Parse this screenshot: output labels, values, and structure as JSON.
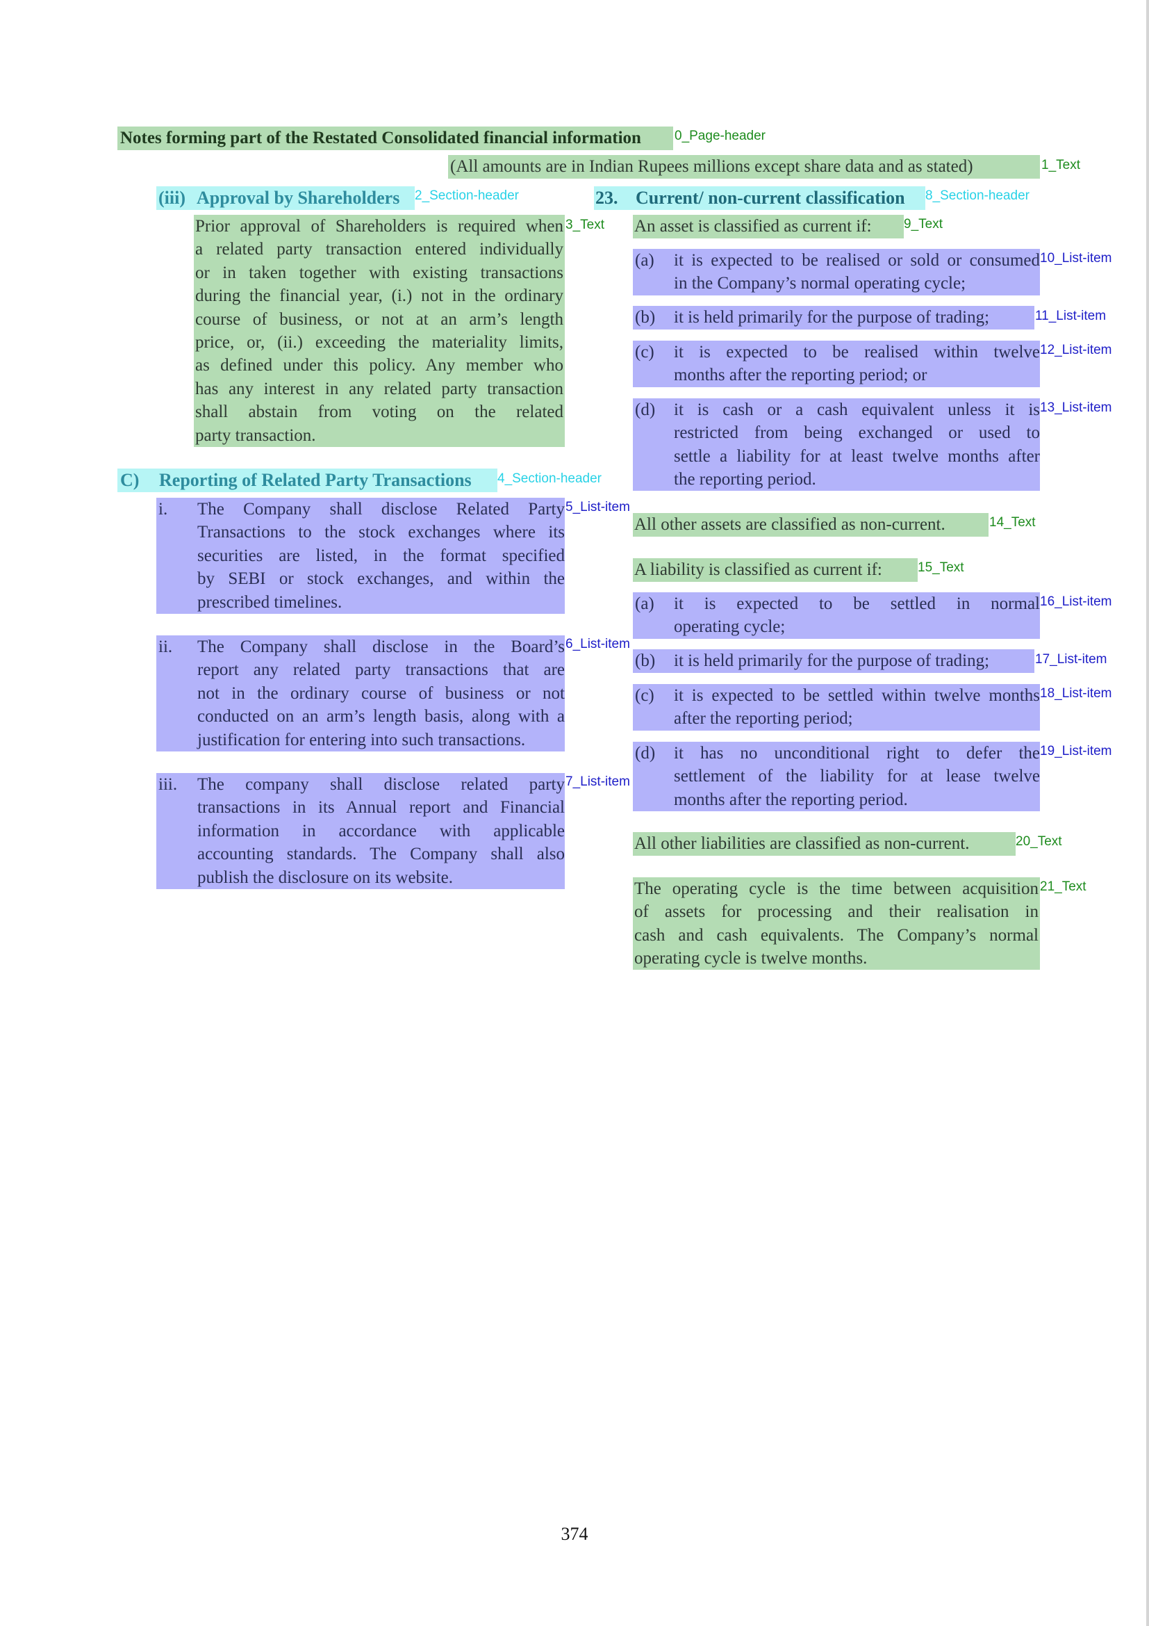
{
  "page_header": "Notes forming part of the Restated Consolidated financial information",
  "currency_note": "(All amounts are in Indian Rupees millions except share data and as stated)",
  "labels": {
    "l0": "0_Page-header",
    "l1": "1_Text",
    "l2": "2_Section-header",
    "l3": "3_Text",
    "l4": "4_Section-header",
    "l5": "5_List-item",
    "l6": "6_List-item",
    "l7": "7_List-item",
    "l8": "8_Section-header",
    "l9": "9_Text",
    "l10": "10_List-item",
    "l11": "11_List-item",
    "l12": "12_List-item",
    "l13": "13_List-item",
    "l14": "14_Text",
    "l15": "15_Text",
    "l16": "16_List-item",
    "l17": "17_List-item",
    "l18": "18_List-item",
    "l19": "19_List-item",
    "l20": "20_Text",
    "l21": "21_Text"
  },
  "left": {
    "approval": {
      "num": "(iii)",
      "title": "Approval by Shareholders",
      "lines": [
        "Prior approval of Shareholders is required when",
        "a related party transaction entered individually",
        "or in taken together with existing transactions",
        "during the financial year, (i.) not in the ordinary",
        "course of business, or not at an arm’s length",
        "price, or, (ii.) exceeding the materiality limits,",
        "as defined under this policy. Any member who",
        "has any interest in any related party transaction",
        "shall abstain from voting on the related",
        "party transaction."
      ]
    },
    "reporting": {
      "num": "C)",
      "title": "Reporting of Related Party Transactions",
      "items": [
        {
          "marker": "i.",
          "lines": [
            "The Company shall disclose Related Party",
            "Transactions to the stock exchanges where its",
            "securities are listed, in the format specified",
            "by SEBI or stock exchanges, and within the",
            "prescribed timelines."
          ]
        },
        {
          "marker": "ii.",
          "lines": [
            "The Company shall disclose in the Board’s",
            "report any related party transactions that are",
            "not in the ordinary course of business or not",
            "conducted on an arm’s length basis, along with a",
            "justification for entering into such transactions."
          ]
        },
        {
          "marker": "iii.",
          "lines": [
            "The company shall disclose related party",
            "transactions in its Annual report and Financial",
            "information in accordance with applicable",
            "accounting standards. The Company shall also",
            "publish the disclosure on its website."
          ]
        }
      ]
    }
  },
  "right": {
    "num": "23.",
    "title": "Current/ non-current classification",
    "asset_intro": "An asset is classified as current if:",
    "asset_items": [
      {
        "marker": "(a)",
        "lines": [
          "it is expected to be realised or sold or consumed",
          "in the Company’s normal operating cycle;"
        ]
      },
      {
        "marker": "(b)",
        "lines": [
          "it is held primarily for the purpose of trading;"
        ]
      },
      {
        "marker": "(c)",
        "lines": [
          "it is expected to be realised within twelve",
          "months after the reporting period; or"
        ]
      },
      {
        "marker": "(d)",
        "lines": [
          "it is cash or a cash equivalent unless it is",
          "restricted from being exchanged or used to",
          "settle a liability for at least twelve months after",
          "the reporting period."
        ]
      }
    ],
    "asset_other": "All other assets are classified as non-current.",
    "liability_intro": "A liability is classified as current if:",
    "liability_items": [
      {
        "marker": "(a)",
        "lines": [
          "it is expected to be settled in normal",
          "operating cycle;"
        ]
      },
      {
        "marker": "(b)",
        "lines": [
          "it is held primarily for the purpose of trading;"
        ]
      },
      {
        "marker": "(c)",
        "lines": [
          "it is expected to be settled within twelve months",
          "after the reporting period;"
        ]
      },
      {
        "marker": "(d)",
        "lines": [
          "it has no unconditional right to defer the",
          "settlement of the liability for at lease twelve",
          "months after the reporting period."
        ]
      }
    ],
    "liability_other": "All other liabilities are classified as non-current.",
    "operating_cycle": [
      "The operating cycle is the time between acquisition",
      "of assets for processing and their realisation in",
      "cash and cash equivalents. The Company’s normal",
      "operating cycle is twelve months."
    ]
  },
  "page_number": "374"
}
